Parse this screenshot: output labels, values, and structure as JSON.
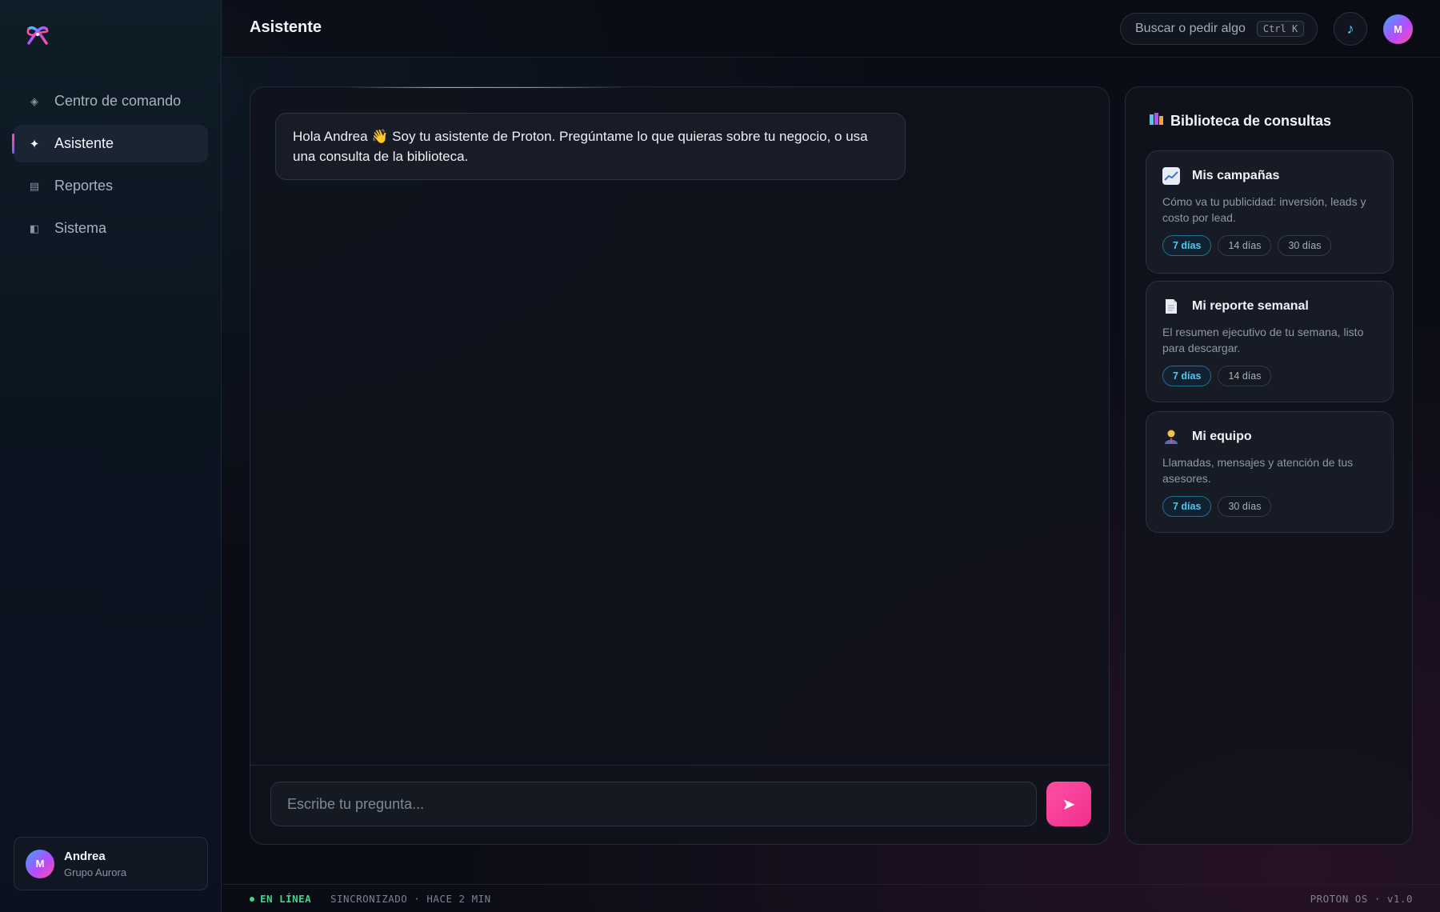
{
  "app": {
    "page_title": "Asistente"
  },
  "sidebar": {
    "items": [
      {
        "label": "Centro de comando",
        "icon": "diamond-icon"
      },
      {
        "label": "Asistente",
        "icon": "sparkle-icon",
        "active": true
      },
      {
        "label": "Reportes",
        "icon": "list-icon"
      },
      {
        "label": "Sistema",
        "icon": "panel-icon"
      }
    ],
    "user": {
      "initial": "M",
      "name": "Andrea",
      "org": "Grupo Aurora"
    }
  },
  "header": {
    "search_label": "Buscar o pedir algo",
    "search_shortcut": "Ctrl K",
    "music_icon": "music-note-icon",
    "avatar_initial": "M"
  },
  "chat": {
    "greeting": "Hola Andrea 👋 Soy tu asistente de Proton. Pregúntame lo que quieras sobre tu negocio, o usa una consulta de la biblioteca.",
    "input_placeholder": "Escribe tu pregunta...",
    "send_icon": "send-arrow-icon"
  },
  "library": {
    "title": "Biblioteca de consultas",
    "title_icon": "books-icon",
    "cards": [
      {
        "icon": "chart-up-icon",
        "title": "Mis campañas",
        "description": "Cómo va tu publicidad: inversión, leads y costo por lead.",
        "chips": [
          "7 días",
          "14 días",
          "30 días"
        ],
        "selected": "7 días"
      },
      {
        "icon": "document-icon",
        "title": "Mi reporte semanal",
        "description": "El resumen ejecutivo de tu semana, listo para descargar.",
        "chips": [
          "7 días",
          "14 días"
        ],
        "selected": "7 días"
      },
      {
        "icon": "person-icon",
        "title": "Mi equipo",
        "description": "Llamadas, mensajes y atención de tus asesores.",
        "chips": [
          "7 días",
          "30 días"
        ],
        "selected": "7 días"
      }
    ]
  },
  "statusbar": {
    "online": "EN LÍNEA",
    "sync": "SINCRONIZADO · HACE 2 MIN",
    "version": "PROTON OS · v1.0"
  },
  "colors": {
    "accent_pink": "#ff4fa3",
    "accent_cyan": "#4cc8f2",
    "online_green": "#3fd68a"
  }
}
